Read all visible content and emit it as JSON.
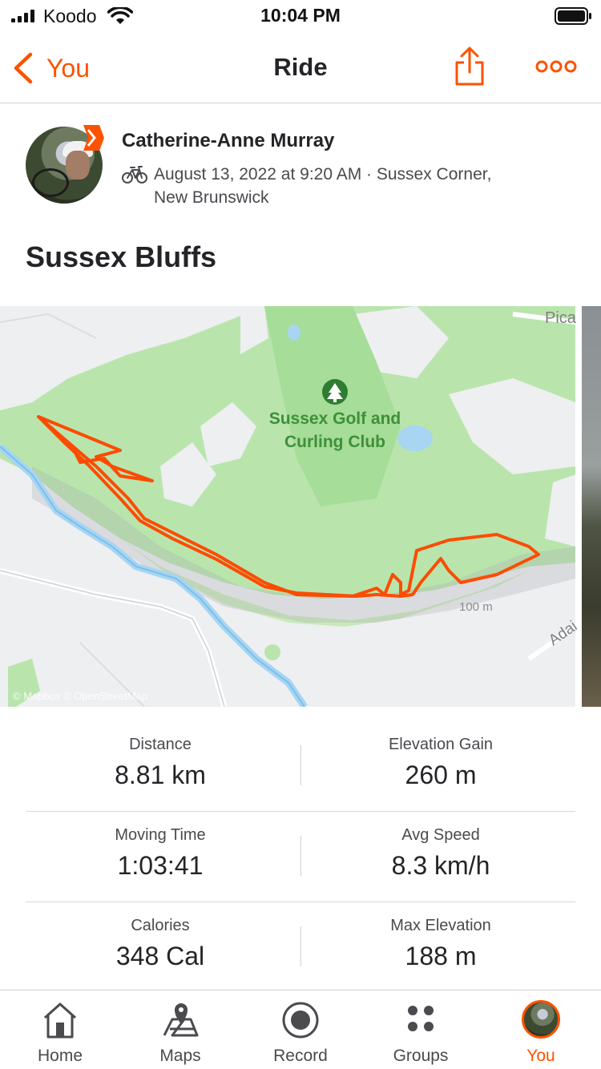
{
  "status_bar": {
    "carrier": "Koodo",
    "time": "10:04 PM"
  },
  "nav": {
    "back_label": "You",
    "title": "Ride"
  },
  "athlete": {
    "name": "Catherine-Anne Murray"
  },
  "activity": {
    "meta": "August 13, 2022 at 9:20 AM · Sussex Corner, New Brunswick",
    "title": "Sussex Bluffs",
    "type_icon": "bike-icon"
  },
  "map": {
    "poi_name": "Sussex Golf and Curling Club",
    "road_pica": "Pica",
    "road_adai": "Adai",
    "contour_label": "100 m",
    "attribution": "© Mapbox © OpenStreetMap",
    "route_color": "#fc4c02",
    "park_color": "#b9e5ad"
  },
  "stats": [
    {
      "left": {
        "label": "Distance",
        "value": "8.81 km"
      },
      "right": {
        "label": "Elevation Gain",
        "value": "260 m"
      }
    },
    {
      "left": {
        "label": "Moving Time",
        "value": "1:03:41"
      },
      "right": {
        "label": "Avg Speed",
        "value": "8.3 km/h"
      }
    },
    {
      "left": {
        "label": "Calories",
        "value": "348 Cal"
      },
      "right": {
        "label": "Max Elevation",
        "value": "188 m"
      }
    }
  ],
  "tabs": [
    {
      "label": "Home",
      "icon": "home-icon"
    },
    {
      "label": "Maps",
      "icon": "map-icon"
    },
    {
      "label": "Record",
      "icon": "record-icon"
    },
    {
      "label": "Groups",
      "icon": "groups-icon"
    },
    {
      "label": "You",
      "icon": "avatar",
      "active": true
    }
  ],
  "colors": {
    "accent": "#fc5200",
    "text_primary": "#242428",
    "text_secondary": "#4a4a4f"
  }
}
